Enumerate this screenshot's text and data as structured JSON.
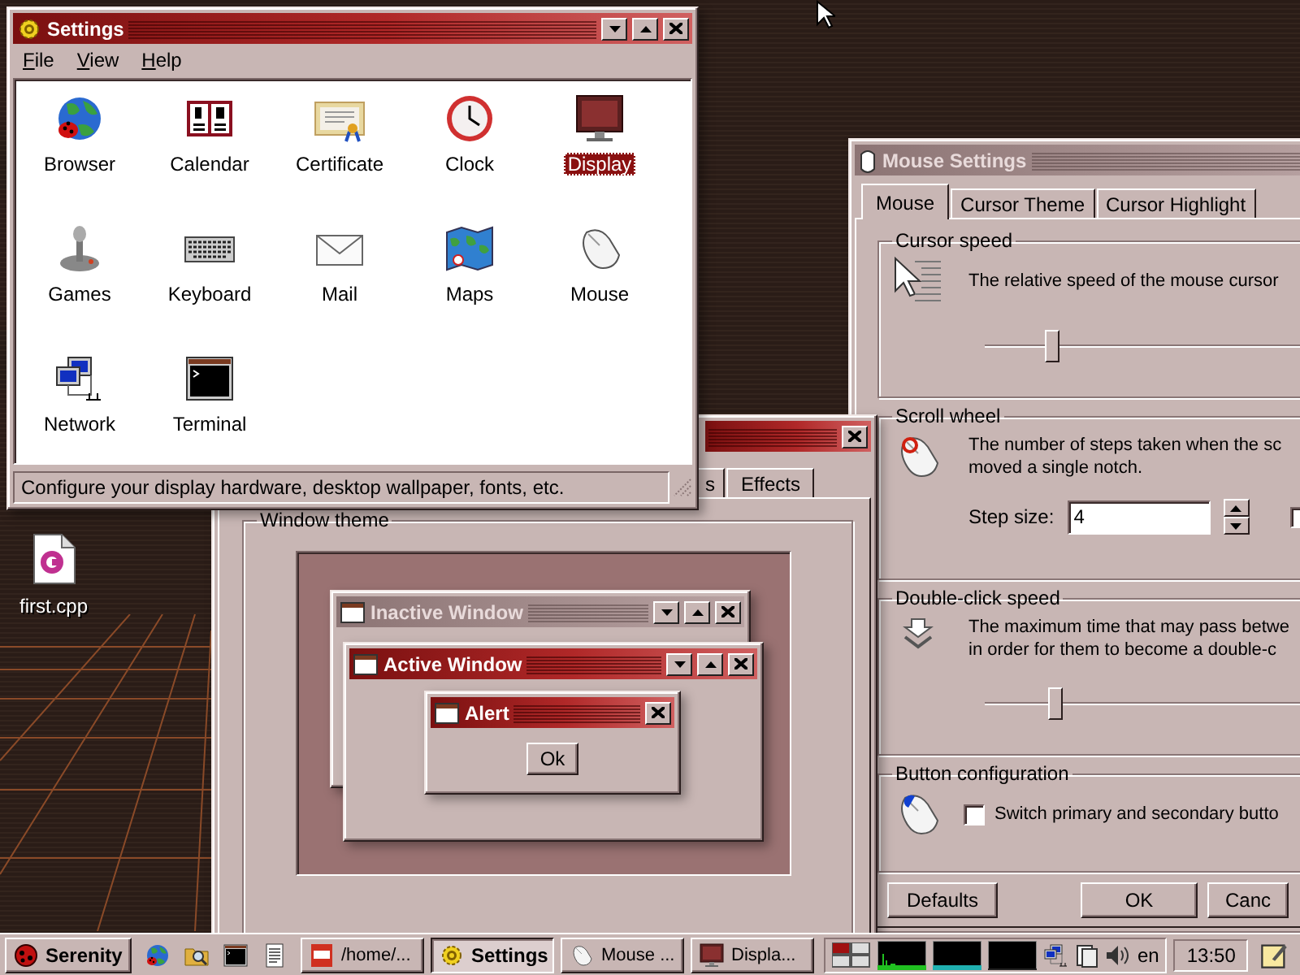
{
  "desktop": {
    "icons": [
      {
        "label": "first.cpp"
      }
    ]
  },
  "settings_window": {
    "title": "Settings",
    "active": true,
    "menu": [
      "File",
      "View",
      "Help"
    ],
    "items": [
      {
        "label": "Browser",
        "selected": false
      },
      {
        "label": "Calendar",
        "selected": false
      },
      {
        "label": "Certificate",
        "selected": false
      },
      {
        "label": "Clock",
        "selected": false
      },
      {
        "label": "Display",
        "selected": true
      },
      {
        "label": "Games",
        "selected": false
      },
      {
        "label": "Keyboard",
        "selected": false
      },
      {
        "label": "Mail",
        "selected": false
      },
      {
        "label": "Maps",
        "selected": false
      },
      {
        "label": "Mouse",
        "selected": false
      },
      {
        "label": "Network",
        "selected": false
      },
      {
        "label": "Terminal",
        "selected": false
      }
    ],
    "status": "Configure your display hardware, desktop wallpaper, fonts, etc."
  },
  "display_window": {
    "tabs": [
      {
        "label": "s",
        "selected": false
      },
      {
        "label": "Effects",
        "selected": false
      }
    ],
    "theme_group": {
      "title": "Window theme",
      "preview_windows": [
        {
          "title": "Inactive Window",
          "active": false,
          "kind": "normal"
        },
        {
          "title": "Active Window",
          "active": true,
          "kind": "normal"
        },
        {
          "title": "Alert",
          "active": true,
          "kind": "alert",
          "button": "Ok"
        }
      ]
    }
  },
  "mouse_window": {
    "title": "Mouse Settings",
    "active": false,
    "tabs": [
      {
        "label": "Mouse",
        "selected": true
      },
      {
        "label": "Cursor Theme",
        "selected": false
      },
      {
        "label": "Cursor Highlight",
        "selected": false
      }
    ],
    "cursor_speed": {
      "title": "Cursor speed",
      "description": [
        "The relative speed of the mouse cursor"
      ],
      "level": 0.2
    },
    "scroll_wheel": {
      "title": "Scroll wheel",
      "description": [
        "The number of steps taken when the sc",
        "moved a single notch."
      ],
      "step_size_label": "Step size:",
      "step_size": "4",
      "checkbox_checked": false
    },
    "double_click_speed": {
      "title": "Double-click speed",
      "description": [
        "The maximum time that may pass betwe",
        "in order for them to become a double-c"
      ],
      "level": 0.21
    },
    "button_configuration": {
      "title": "Button configuration",
      "switch_label": "Switch primary and secondary butto",
      "switch_checked": false
    },
    "buttons": [
      "Defaults",
      "OK",
      "Canc"
    ]
  },
  "taskbar": {
    "start": "Serenity",
    "tasks": [
      {
        "label": "/home/...",
        "selected": false
      },
      {
        "label": "Settings",
        "selected": true
      },
      {
        "label": "Mouse ...",
        "selected": false
      },
      {
        "label": "Displa...",
        "selected": false
      }
    ],
    "keyboard_layout": "en",
    "clock": "13:50"
  }
}
